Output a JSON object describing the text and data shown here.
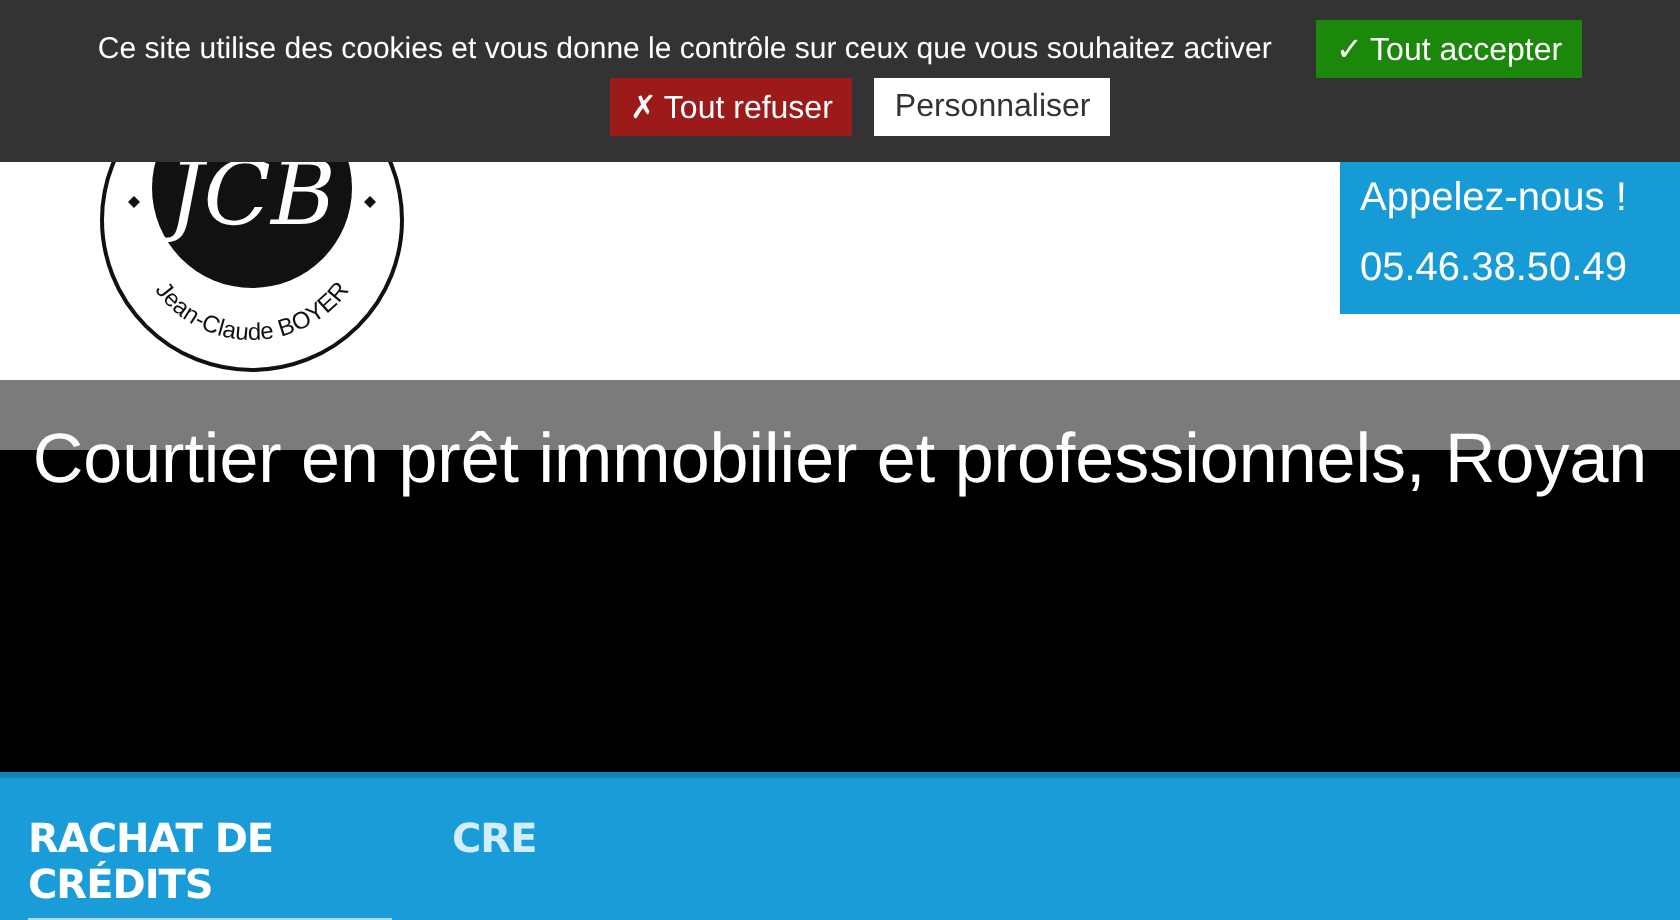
{
  "cookie_banner": {
    "message": "Ce site utilise des cookies et vous donne le contrôle sur ceux que vous souhaitez activer",
    "buttons": [
      {
        "kind": "accept",
        "label": "✓ Tout accepter"
      },
      {
        "kind": "deny",
        "label": "✗ Tout refuser"
      },
      {
        "kind": "custom",
        "label": "Personnaliser"
      }
    ]
  },
  "header": {
    "logo": {
      "monogram": "JCB",
      "name": "Jean-Claude BOYER"
    },
    "call_box": {
      "label": "Appelez-nous !",
      "phone": "05.46.38.50.49"
    }
  },
  "hero": {
    "title": "Courtier en prêt immobilier et professionnels, Royan"
  },
  "slider": {
    "slides": [
      {
        "title": "RACHAT DE CRÉDITS",
        "selected": true
      },
      {
        "title": "CRE",
        "selected": false
      }
    ]
  }
}
